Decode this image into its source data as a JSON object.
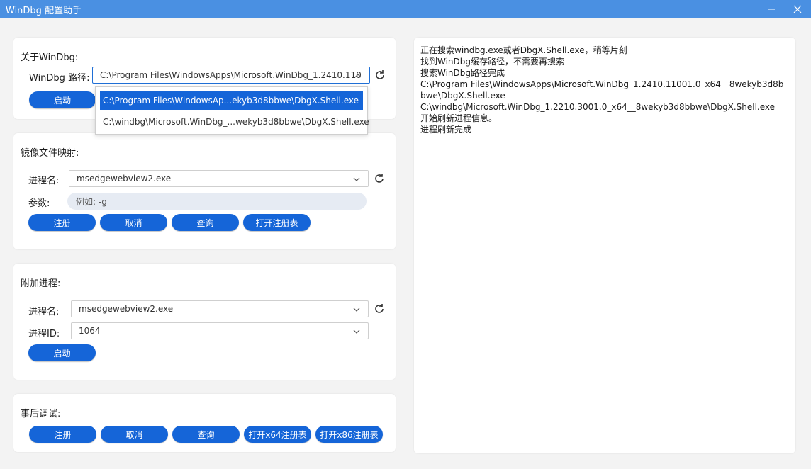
{
  "window": {
    "title": "WinDbg 配置助手",
    "minimize_icon": "minimize-icon",
    "close_icon": "close-icon"
  },
  "about": {
    "heading": "关于WinDbg:",
    "path_label": "WinDbg 路径:",
    "path_value": "C:\\Program Files\\WindowsApps\\Microsoft.WinDbg_1.2410.110",
    "launch_label": "启动",
    "dropdown_items": [
      "C:\\Program Files\\WindowsAp...ekyb3d8bbwe\\DbgX.Shell.exe",
      "C:\\windbg\\Microsoft.WinDbg_...wekyb3d8bbwe\\DbgX.Shell.exe"
    ]
  },
  "image_mapping": {
    "heading": "镜像文件映射:",
    "process_label": "进程名:",
    "process_value": "msedgewebview2.exe",
    "args_label": "参数:",
    "args_placeholder": "例如: -g",
    "buttons": [
      "注册",
      "取消",
      "查询",
      "打开注册表"
    ]
  },
  "attach": {
    "heading": "附加进程:",
    "process_label": "进程名:",
    "process_value": "msedgewebview2.exe",
    "pid_label": "进程ID:",
    "pid_value": "1064",
    "launch_label": "启动"
  },
  "postmortem": {
    "heading": "事后调试:",
    "buttons": [
      "注册",
      "取消",
      "查询",
      "打开x64注册表",
      "打开x86注册表"
    ]
  },
  "log": {
    "lines": [
      "正在搜索windbg.exe或者DbgX.Shell.exe，稍等片刻",
      "找到WinDbg缓存路径，不需要再搜索",
      "搜索WinDbg路径完成",
      "C:\\Program Files\\WindowsApps\\Microsoft.WinDbg_1.2410.11001.0_x64__8wekyb3d8bbwe\\DbgX.Shell.exe",
      "C:\\windbg\\Microsoft.WinDbg_1.2210.3001.0_x64__8wekyb3d8bbwe\\DbgX.Shell.exe",
      "开始刷新进程信息。",
      "进程刷新完成"
    ]
  },
  "colors": {
    "titlebar": "#4a90e2",
    "button": "#1565d8",
    "background": "#f3f3f3"
  }
}
